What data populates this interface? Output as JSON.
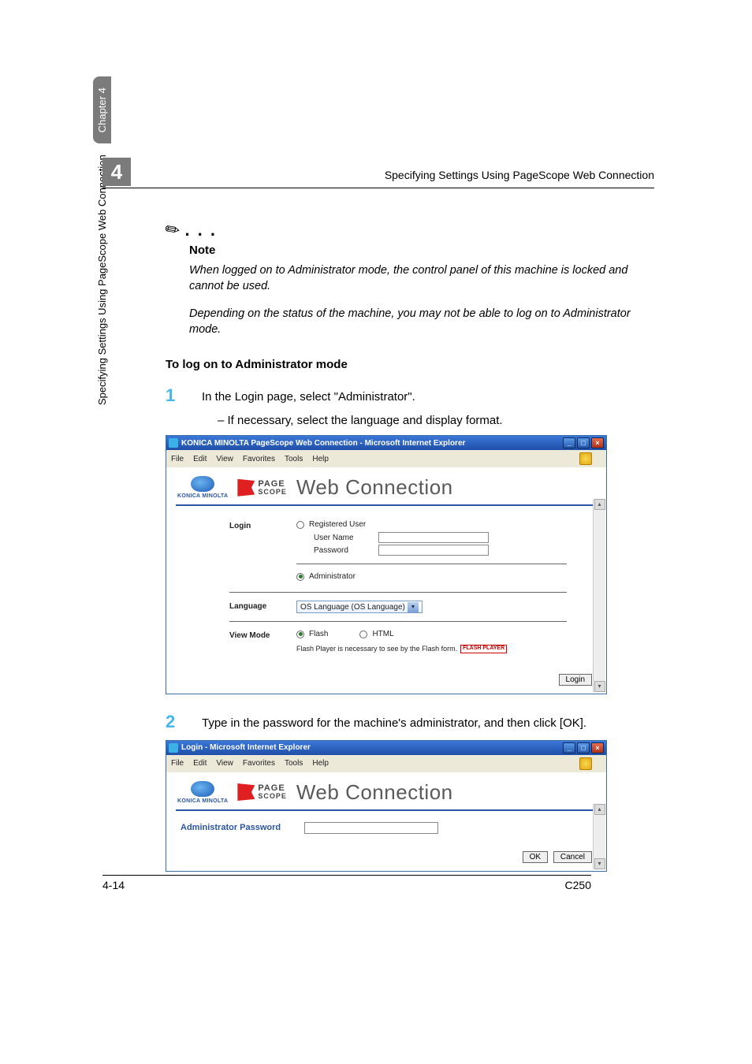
{
  "header": {
    "chapter_number": "4",
    "title": "Specifying Settings Using PageScope Web Connection"
  },
  "side_tab": {
    "section": "Specifying Settings Using PageScope Web Connection",
    "chapter": "Chapter 4"
  },
  "note": {
    "label": "Note",
    "para1": "When logged on to Administrator mode, the control panel of this machine is locked and cannot be used.",
    "para2": "Depending on the status of the machine, you may not be able to log on to Administrator mode."
  },
  "subheading": "To log on to Administrator mode",
  "steps": {
    "s1": {
      "num": "1",
      "text": "In the Login page, select \"Administrator\".",
      "sub": "If necessary, select the language and display format."
    },
    "s2": {
      "num": "2",
      "text": "Type in the password for the machine's administrator, and then click [OK]."
    }
  },
  "browser1": {
    "title": "KONICA MINOLTA PageScope Web Connection - Microsoft Internet Explorer",
    "menus": [
      "File",
      "Edit",
      "View",
      "Favorites",
      "Tools",
      "Help"
    ],
    "brand_small": "KONICA MINOLTA",
    "ps_line1": "PAGE",
    "ps_line2": "SCOPE",
    "wc": "Web Connection",
    "form": {
      "login_label": "Login",
      "reg_user": "Registered User",
      "user_name": "User Name",
      "password": "Password",
      "administrator": "Administrator",
      "language_label": "Language",
      "language_value": "OS Language (OS Language)",
      "view_label": "View Mode",
      "flash": "Flash",
      "html": "HTML",
      "flash_note": "Flash Player is necessary to see by the Flash form.",
      "flash_badge": "FLASH PLAYER",
      "login_btn": "Login"
    }
  },
  "browser2": {
    "title": "Login - Microsoft Internet Explorer",
    "menus": [
      "File",
      "Edit",
      "View",
      "Favorites",
      "Tools",
      "Help"
    ],
    "brand_small": "KONICA MINOLTA",
    "ps_line1": "PAGE",
    "ps_line2": "SCOPE",
    "wc": "Web Connection",
    "admin_pw_label": "Administrator Password",
    "ok": "OK",
    "cancel": "Cancel"
  },
  "footer": {
    "page": "4-14",
    "model": "C250"
  }
}
